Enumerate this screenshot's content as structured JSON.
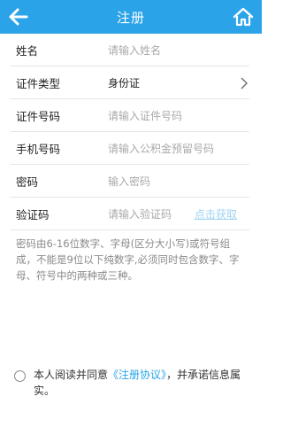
{
  "header": {
    "title": "注册",
    "back_icon": "arrow-left-icon",
    "home_icon": "home-icon",
    "color": "#2aa3e9"
  },
  "form": {
    "name": {
      "label": "姓名",
      "placeholder": "请输入姓名"
    },
    "id_type": {
      "label": "证件类型",
      "value": "身份证",
      "icon": "chevron-right-icon"
    },
    "id_number": {
      "label": "证件号码",
      "placeholder": "请输入证件号码"
    },
    "phone": {
      "label": "手机号码",
      "placeholder": "请输入公积金预留号码"
    },
    "password": {
      "label": "密码",
      "placeholder": "输入密码"
    },
    "code": {
      "label": "验证码",
      "placeholder": "请输入验证码",
      "button": "点击获取"
    }
  },
  "hint": "密码由6-16位数字、字母(区分大小写)或符号组成，不能是9位以下纯数字,必须同时包含数字、字母、符号中的两种或三种。",
  "agreement": {
    "prefix": "本人阅读并同意",
    "link": "《注册协议》",
    "suffix": "，并承诺信息属实。"
  }
}
